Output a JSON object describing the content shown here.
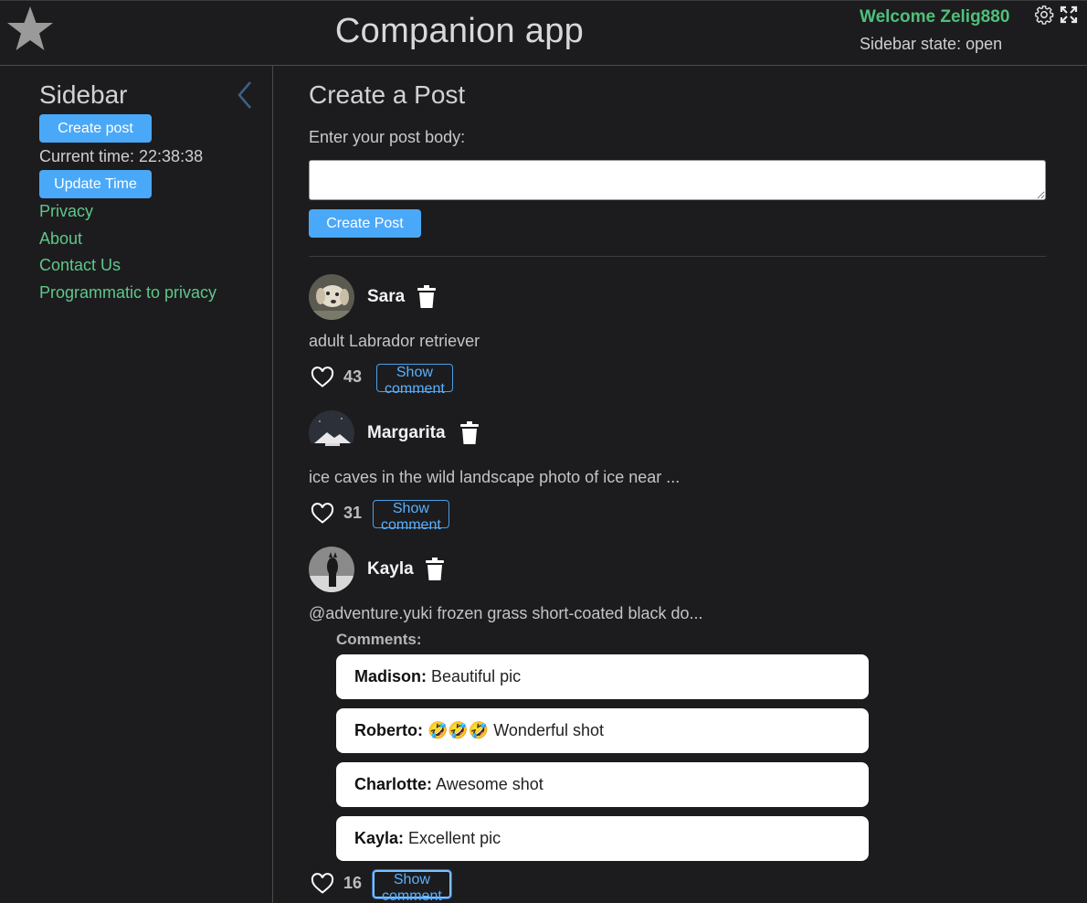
{
  "header": {
    "title": "Companion app",
    "welcome": "Welcome Zelig880",
    "sidebar_state": "Sidebar state: open",
    "icons": [
      "star-logo-icon",
      "gear-icon",
      "fullscreen-icon"
    ]
  },
  "sidebar": {
    "title": "Sidebar",
    "create_post_label": "Create post",
    "current_time": "Current time: 22:38:38",
    "update_time_label": "Update Time",
    "links": [
      "Privacy",
      "About",
      "Contact Us",
      "Programmatic to privacy"
    ]
  },
  "main": {
    "title": "Create a Post",
    "body_label": "Enter your post body:",
    "body_value": "",
    "create_button": "Create Post"
  },
  "posts": [
    {
      "author": "Sara",
      "body": "adult Labrador retriever",
      "likes": "43",
      "show_comment_label": "Show comment",
      "avatar": "dog-photo"
    },
    {
      "author": "Margarita",
      "body": "ice caves in the wild landscape photo of ice near ...",
      "likes": "31",
      "show_comment_label": "Show comment",
      "avatar": "ice-mountain-photo"
    },
    {
      "author": "Kayla",
      "body": "@adventure.yuki frozen grass short-coated black do...",
      "likes": "16",
      "show_comment_label": "Show comment",
      "avatar": "black-dog-photo",
      "comments_label": "Comments:",
      "comments": [
        {
          "author": "Madison:",
          "text": "Beautiful pic"
        },
        {
          "author": "Roberto:",
          "text": "🤣🤣🤣 Wonderful shot"
        },
        {
          "author": "Charlotte:",
          "text": "Awesome shot"
        },
        {
          "author": "Kayla:",
          "text": "Excellent pic"
        }
      ]
    }
  ],
  "colors": {
    "background": "#1c1c1e",
    "accent_blue": "#4aa8f8",
    "link_green": "#5fc78a",
    "welcome_green": "#4fc07a"
  }
}
